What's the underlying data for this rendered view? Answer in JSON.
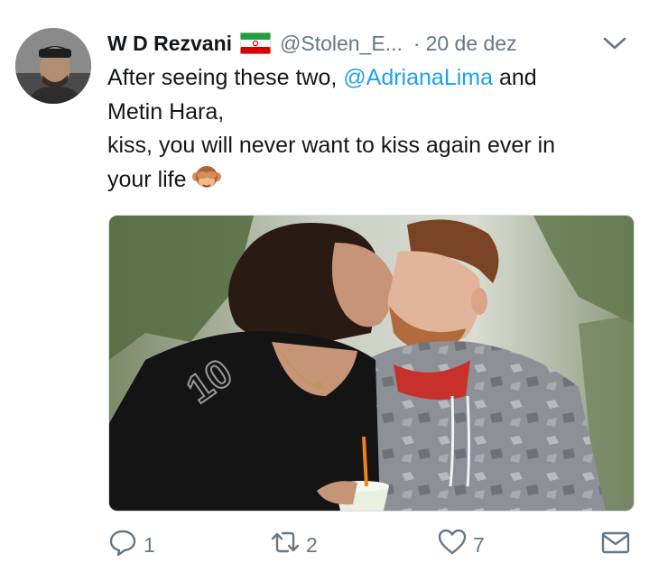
{
  "tweet": {
    "author_name": "W D Rezvani",
    "handle": "@Stolen_E...",
    "separator": "·",
    "date": "20 de dez",
    "text_before": "After seeing these two, ",
    "mention": "@AdrianaLima",
    "text_line1_end": " and",
    "text_line2": "Metin Hara,",
    "text_line3": "kiss, you will never want to kiss again ever in",
    "text_line4": "your life",
    "emoji_icon": "see-no-evil-monkey-icon",
    "flag_icon": "iran-flag-icon",
    "media_description_icon": "photo-media"
  },
  "actions": {
    "reply_count": "1",
    "retweet_count": "2",
    "like_count": "7",
    "share_icon": "envelope-icon"
  },
  "colors": {
    "link": "#1da1f2",
    "secondary_text": "#657786",
    "primary_text": "#14171a"
  }
}
